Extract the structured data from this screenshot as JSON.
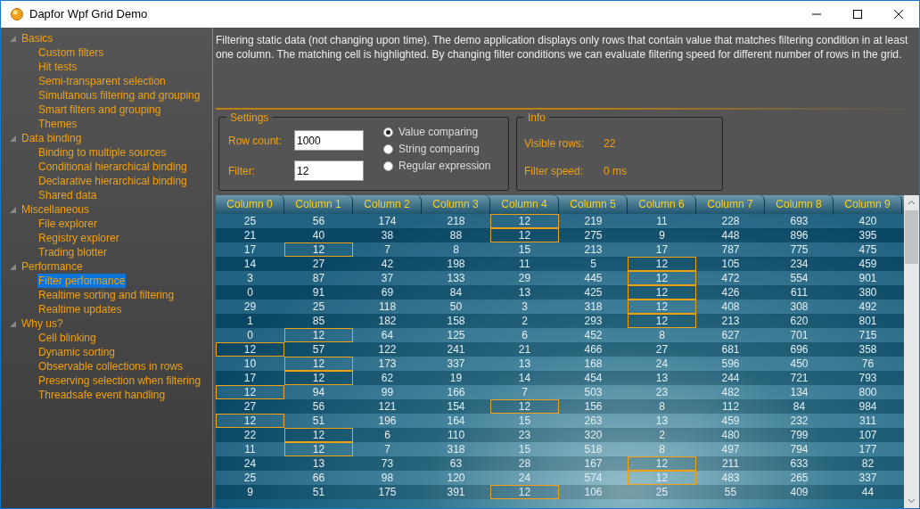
{
  "window": {
    "title": "Dapfor Wpf Grid Demo"
  },
  "sidebar": {
    "items": [
      {
        "label": "Basics",
        "expanded": true,
        "children": [
          {
            "label": "Custom filters",
            "selected": false
          },
          {
            "label": "Hit tests",
            "selected": false
          },
          {
            "label": "Semi-transparent selection",
            "selected": false
          },
          {
            "label": "Simultanous filtering and grouping",
            "selected": false
          },
          {
            "label": "Smart filters and grouping",
            "selected": false
          },
          {
            "label": "Themes",
            "selected": false
          }
        ]
      },
      {
        "label": "Data binding",
        "expanded": true,
        "children": [
          {
            "label": "Binding to multiple sources",
            "selected": false
          },
          {
            "label": "Conditional hierarchical binding",
            "selected": false
          },
          {
            "label": "Declarative hierarchical binding",
            "selected": false
          },
          {
            "label": "Shared data",
            "selected": false
          }
        ]
      },
      {
        "label": "Miscellaneous",
        "expanded": true,
        "children": [
          {
            "label": "File explorer",
            "selected": false
          },
          {
            "label": "Registry explorer",
            "selected": false
          },
          {
            "label": "Trading blotter",
            "selected": false
          }
        ]
      },
      {
        "label": "Performance",
        "expanded": true,
        "children": [
          {
            "label": "Filter performance",
            "selected": true
          },
          {
            "label": "Realtime sorting and filtering",
            "selected": false
          },
          {
            "label": "Realtime updates",
            "selected": false
          }
        ]
      },
      {
        "label": "Why us?",
        "expanded": true,
        "children": [
          {
            "label": "Cell blinking",
            "selected": false
          },
          {
            "label": "Dynamic sorting",
            "selected": false
          },
          {
            "label": "Observable collections in rows",
            "selected": false
          },
          {
            "label": "Preserving selection when filtering",
            "selected": false
          },
          {
            "label": "Threadsafe event handling",
            "selected": false
          }
        ]
      }
    ]
  },
  "description": "Filtering static data (not changing upon time). The demo application displays only rows that contain value that matches filtering condition in at least one column. The matching cell is highlighted. By changing filter conditions we can evaluate filtering speed for different number of rows in the grid.",
  "settings": {
    "title": "Settings",
    "fields": [
      {
        "label": "Row count:",
        "value": "1000"
      },
      {
        "label": "Filter:",
        "value": "12"
      }
    ],
    "modes": [
      {
        "label": "Value comparing",
        "selected": true
      },
      {
        "label": "String comparing",
        "selected": false
      },
      {
        "label": "Regular expression",
        "selected": false
      }
    ]
  },
  "info": {
    "title": "Info",
    "rows": [
      {
        "label": "Visible rows:",
        "value": "22"
      },
      {
        "label": "Filter speed:",
        "value": "0 ms"
      }
    ]
  },
  "table": {
    "columns": [
      "Column 0",
      "Column 1",
      "Column 2",
      "Column 3",
      "Column 4",
      "Column 5",
      "Column 6",
      "Column 7",
      "Column 8",
      "Column 9"
    ],
    "rows": [
      {
        "cells": [
          "25",
          "56",
          "174",
          "218",
          "12",
          "219",
          "11",
          "228",
          "693",
          "420"
        ],
        "highlighted": [
          false,
          false,
          false,
          false,
          true,
          false,
          false,
          false,
          false,
          false
        ]
      },
      {
        "cells": [
          "21",
          "40",
          "38",
          "88",
          "12",
          "275",
          "9",
          "448",
          "896",
          "395"
        ],
        "highlighted": [
          false,
          false,
          false,
          false,
          true,
          false,
          false,
          false,
          false,
          false
        ]
      },
      {
        "cells": [
          "17",
          "12",
          "7",
          "8",
          "15",
          "213",
          "17",
          "787",
          "775",
          "475"
        ],
        "highlighted": [
          false,
          true,
          false,
          false,
          false,
          false,
          false,
          false,
          false,
          false
        ]
      },
      {
        "cells": [
          "14",
          "27",
          "42",
          "198",
          "11",
          "5",
          "12",
          "105",
          "234",
          "459"
        ],
        "highlighted": [
          false,
          false,
          false,
          false,
          false,
          false,
          true,
          false,
          false,
          false
        ]
      },
      {
        "cells": [
          "3",
          "87",
          "37",
          "133",
          "29",
          "445",
          "12",
          "472",
          "554",
          "901"
        ],
        "highlighted": [
          false,
          false,
          false,
          false,
          false,
          false,
          true,
          false,
          false,
          false
        ]
      },
      {
        "cells": [
          "0",
          "91",
          "69",
          "84",
          "13",
          "425",
          "12",
          "426",
          "611",
          "380"
        ],
        "highlighted": [
          false,
          false,
          false,
          false,
          false,
          false,
          true,
          false,
          false,
          false
        ]
      },
      {
        "cells": [
          "29",
          "25",
          "118",
          "50",
          "3",
          "318",
          "12",
          "408",
          "308",
          "492"
        ],
        "highlighted": [
          false,
          false,
          false,
          false,
          false,
          false,
          true,
          false,
          false,
          false
        ]
      },
      {
        "cells": [
          "1",
          "85",
          "182",
          "158",
          "2",
          "293",
          "12",
          "213",
          "620",
          "801"
        ],
        "highlighted": [
          false,
          false,
          false,
          false,
          false,
          false,
          true,
          false,
          false,
          false
        ]
      },
      {
        "cells": [
          "0",
          "12",
          "64",
          "125",
          "6",
          "452",
          "8",
          "627",
          "701",
          "715"
        ],
        "highlighted": [
          false,
          true,
          false,
          false,
          false,
          false,
          false,
          false,
          false,
          false
        ]
      },
      {
        "cells": [
          "12",
          "57",
          "122",
          "241",
          "21",
          "466",
          "27",
          "681",
          "696",
          "358"
        ],
        "highlighted": [
          true,
          false,
          false,
          false,
          false,
          false,
          false,
          false,
          false,
          false
        ]
      },
      {
        "cells": [
          "10",
          "12",
          "173",
          "337",
          "13",
          "168",
          "24",
          "596",
          "450",
          "76"
        ],
        "highlighted": [
          false,
          true,
          false,
          false,
          false,
          false,
          false,
          false,
          false,
          false
        ]
      },
      {
        "cells": [
          "17",
          "12",
          "62",
          "19",
          "14",
          "454",
          "13",
          "244",
          "721",
          "793"
        ],
        "highlighted": [
          false,
          true,
          false,
          false,
          false,
          false,
          false,
          false,
          false,
          false
        ]
      },
      {
        "cells": [
          "12",
          "94",
          "99",
          "166",
          "7",
          "503",
          "23",
          "482",
          "134",
          "800"
        ],
        "highlighted": [
          true,
          false,
          false,
          false,
          false,
          false,
          false,
          false,
          false,
          false
        ]
      },
      {
        "cells": [
          "27",
          "56",
          "121",
          "154",
          "12",
          "156",
          "8",
          "112",
          "84",
          "984"
        ],
        "highlighted": [
          false,
          false,
          false,
          false,
          true,
          false,
          false,
          false,
          false,
          false
        ]
      },
      {
        "cells": [
          "12",
          "51",
          "196",
          "164",
          "15",
          "263",
          "13",
          "459",
          "232",
          "311"
        ],
        "highlighted": [
          true,
          false,
          false,
          false,
          false,
          false,
          false,
          false,
          false,
          false
        ]
      },
      {
        "cells": [
          "22",
          "12",
          "6",
          "110",
          "23",
          "320",
          "2",
          "480",
          "799",
          "107"
        ],
        "highlighted": [
          false,
          true,
          false,
          false,
          false,
          false,
          false,
          false,
          false,
          false
        ]
      },
      {
        "cells": [
          "11",
          "12",
          "7",
          "318",
          "15",
          "518",
          "8",
          "497",
          "794",
          "177"
        ],
        "highlighted": [
          false,
          true,
          false,
          false,
          false,
          false,
          false,
          false,
          false,
          false
        ]
      },
      {
        "cells": [
          "24",
          "13",
          "73",
          "63",
          "28",
          "167",
          "12",
          "211",
          "633",
          "82"
        ],
        "highlighted": [
          false,
          false,
          false,
          false,
          false,
          false,
          true,
          false,
          false,
          false
        ]
      },
      {
        "cells": [
          "25",
          "66",
          "98",
          "120",
          "24",
          "574",
          "12",
          "483",
          "265",
          "337"
        ],
        "highlighted": [
          false,
          false,
          false,
          false,
          false,
          false,
          true,
          false,
          false,
          false
        ]
      },
      {
        "cells": [
          "9",
          "51",
          "175",
          "391",
          "12",
          "106",
          "25",
          "55",
          "409",
          "44"
        ],
        "highlighted": [
          false,
          false,
          false,
          false,
          true,
          false,
          false,
          false,
          false,
          false
        ]
      }
    ]
  }
}
